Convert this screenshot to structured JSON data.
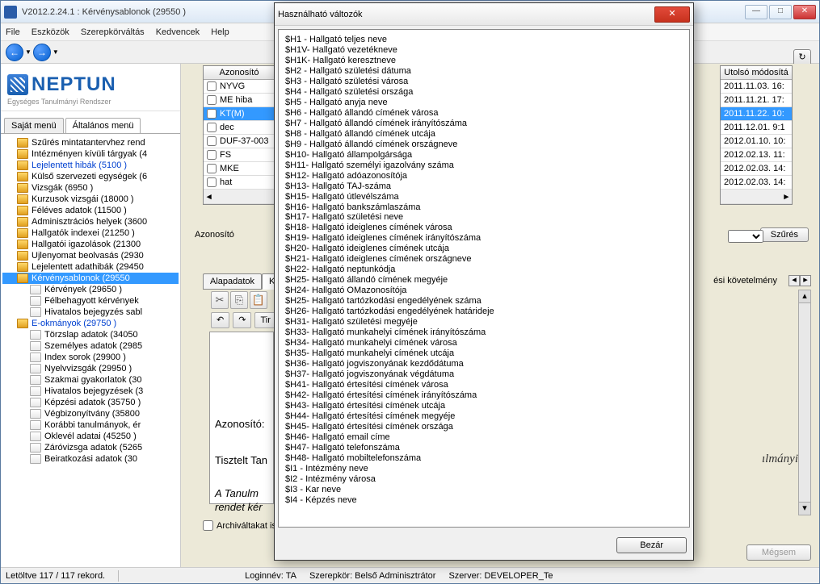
{
  "window": {
    "title": "V2012.2.24.1 : Kérvénysablonok (29550  )"
  },
  "menus": [
    "File",
    "Eszközök",
    "Szerepkörváltás",
    "Kedvencek",
    "Help"
  ],
  "logo": {
    "name": "NEPTUN",
    "tagline": "Egységes Tanulmányi Rendszer"
  },
  "left_tabs": {
    "own": "Saját menü",
    "general": "Általános menü"
  },
  "tree": [
    {
      "t": "Szűrés mintatantervhez rend",
      "lv": 1
    },
    {
      "t": "Intézményen kívüli tárgyak (4",
      "lv": 1
    },
    {
      "t": "Lejelentett hibák (5100  )",
      "lv": 1,
      "link": true
    },
    {
      "t": "Külső szervezeti egységek (6",
      "lv": 1
    },
    {
      "t": "Vizsgák (6950  )",
      "lv": 1
    },
    {
      "t": "Kurzusok vizsgái (18000  )",
      "lv": 1
    },
    {
      "t": "Féléves adatok (11500  )",
      "lv": 1
    },
    {
      "t": "Adminisztrációs helyek (3600",
      "lv": 1
    },
    {
      "t": "Hallgatók indexei (21250  )",
      "lv": 1
    },
    {
      "t": "Hallgatói igazolások (21300",
      "lv": 1
    },
    {
      "t": "Ujlenyomat beolvasás (2930",
      "lv": 1
    },
    {
      "t": "Lejelentett adathibák (29450",
      "lv": 1
    },
    {
      "t": "Kérvénysablonok (29550",
      "lv": 1,
      "sel": true
    },
    {
      "t": "Kérvények (29650  )",
      "lv": 2,
      "ico": "page"
    },
    {
      "t": "Félbehagyott kérvények",
      "lv": 2,
      "ico": "page"
    },
    {
      "t": "Hivatalos bejegyzés sabl",
      "lv": 2,
      "ico": "page"
    },
    {
      "t": "E-okmányok (29750  )",
      "lv": 1,
      "link": true
    },
    {
      "t": "Törzslap adatok (34050",
      "lv": 2,
      "ico": "page"
    },
    {
      "t": "Személyes adatok (2985",
      "lv": 2,
      "ico": "page"
    },
    {
      "t": "Index sorok (29900  )",
      "lv": 2,
      "ico": "page"
    },
    {
      "t": "Nyelvvizsgák (29950  )",
      "lv": 2,
      "ico": "page"
    },
    {
      "t": "Szakmai gyakorlatok (30",
      "lv": 2,
      "ico": "page"
    },
    {
      "t": "Hivatalos bejegyzések (3",
      "lv": 2,
      "ico": "page"
    },
    {
      "t": "Képzési adatok (35750  )",
      "lv": 2,
      "ico": "page"
    },
    {
      "t": "Végbizonyítvány (35800",
      "lv": 2,
      "ico": "page"
    },
    {
      "t": "Korábbi tanulmányok, ér",
      "lv": 2,
      "ico": "page"
    },
    {
      "t": "Oklevél adatai (45250  )",
      "lv": 2,
      "ico": "page"
    },
    {
      "t": "Záróvizsga adatok (5265",
      "lv": 2,
      "ico": "page"
    },
    {
      "t": "Beiratkozási adatok (30",
      "lv": 2,
      "ico": "page"
    }
  ],
  "grid_left": {
    "header": "Azonosító",
    "rows": [
      "NYVG",
      "ME hiba",
      "KT(M)",
      "dec",
      "DUF-37-003",
      "FS",
      "MKE",
      "hat"
    ],
    "sel_index": 2
  },
  "grid_right": {
    "header": "Utolsó módosítá",
    "rows": [
      "2011.11.03. 16:",
      "2011.11.21. 17:",
      "2011.11.22. 10:",
      "2011.12.01. 9:1",
      "2012.01.10. 10:",
      "2012.02.13. 11:",
      "2012.02.03. 14:",
      "2012.02.03. 14:"
    ],
    "sel_index": 2
  },
  "filter": {
    "label": "Azonosító",
    "button": "Szűrés"
  },
  "tabs2": {
    "left": [
      "Alapadatok",
      "Ké"
    ],
    "right": "ési követelmény"
  },
  "toolbar2": [
    "Tir"
  ],
  "preview": {
    "line1": "Azonosító:",
    "line2": "Tisztelt Tan",
    "line3": "A Tanulm",
    "line4": "rendet kér",
    "right": "ılmányi"
  },
  "archiv": "Archiváltakat is",
  "bottom": {
    "save": "",
    "cancel": "Mégsem"
  },
  "status": {
    "records": "Letöltve 117 / 117 rekord.",
    "login": "Loginnév: TA",
    "role": "Szerepkör: Belső Adminisztrátor",
    "server": "Szerver: DEVELOPER_Te"
  },
  "modal": {
    "title": "Használható változók",
    "items": [
      "$H1 - Hallgató teljes neve",
      "$H1V- Hallgató vezetékneve",
      "$H1K- Hallgató keresztneve",
      "$H2 - Hallgató születési dátuma",
      "$H3 - Hallgató születési városa",
      "$H4 - Hallgató születési országa",
      "$H5 - Hallgató anyja neve",
      "$H6 - Hallgató állandó címének városa",
      "$H7 - Hallgató állandó címének irányítószáma",
      "$H8 - Hallgató állandó címének utcája",
      "$H9 - Hallgató állandó címének országneve",
      "$H10- Hallgató állampolgársága",
      "$H11- Hallgató személyi igazolvány száma",
      "$H12- Hallgató adóazonosítója",
      "$H13- Hallgató TAJ-száma",
      "$H15- Hallgató útlevélszáma",
      "$H16- Hallgató bankszámlaszáma",
      "$H17- Hallgató születési neve",
      "$H18- Hallgató ideiglenes címének városa",
      "$H19- Hallgató ideiglenes címének irányítószáma",
      "$H20- Hallgató ideiglenes címének utcája",
      "$H21- Hallgató ideiglenes címének országneve",
      "$H22- Hallgató neptunkódja",
      "$H25- Hallgató állandó címének megyéje",
      "$H24- Hallgató OMazonosítója",
      "$H25- Hallgató tartózkodási engedélyének száma",
      "$H26- Hallgató tartózkodási engedélyének határideje",
      "$H31- Hallgató születési megyéje",
      "$H33- Hallgató munkahelyi címének irányítószáma",
      "$H34- Hallgató munkahelyi címének városa",
      "$H35- Hallgató munkahelyi címének utcája",
      "$H36- Hallgató jogviszonyának kezdődátuma",
      "$H37- Hallgató jogviszonyának végdátuma",
      "$H41- Hallgató értesítési címének városa",
      "$H42- Hallgató értesítési címének irányítószáma",
      "$H43- Hallgató értesítési címének utcája",
      "$H44- Hallgató értesítési címének megyéje",
      "$H45- Hallgató értesítési címének országa",
      "$H46- Hallgató email címe",
      "$H47- Hallgató telefonszáma",
      "$H48- Hallgató mobiltelefonszáma",
      "",
      "$I1 - Intézmény neve",
      "$I2 - Intézmény városa",
      "$I3 - Kar neve",
      "$I4 - Képzés neve"
    ],
    "close": "Bezár"
  }
}
